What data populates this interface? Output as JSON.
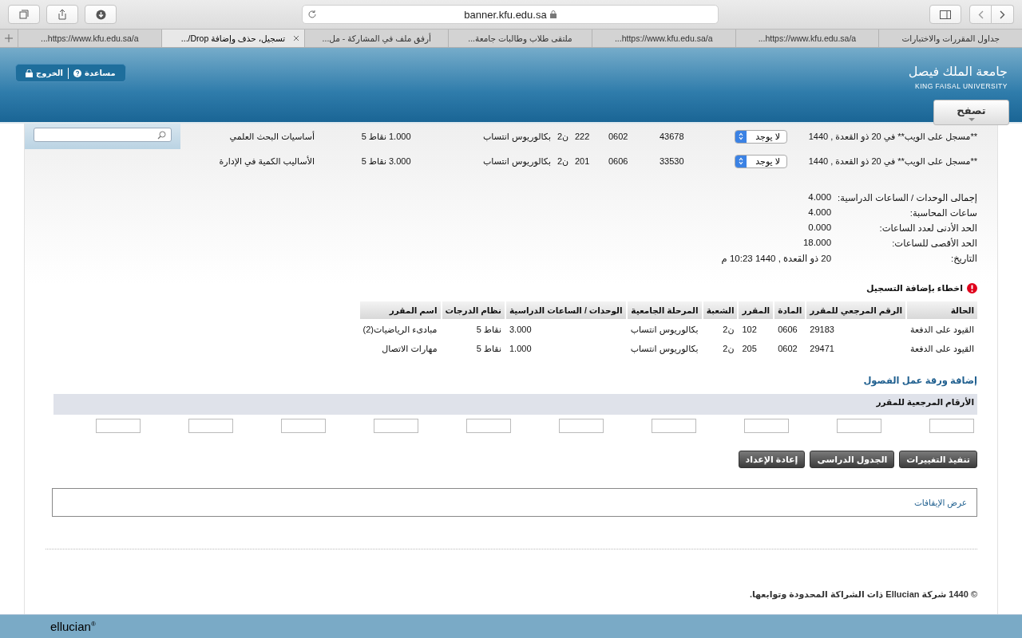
{
  "browser": {
    "url": "banner.kfu.edu.sa",
    "tabs": [
      {
        "title": "جداول المقررات والاختبارات",
        "selected": false
      },
      {
        "title": "https://www.kfu.edu.sa/a...",
        "selected": false
      },
      {
        "title": "https://www.kfu.edu.sa/a...",
        "selected": false
      },
      {
        "title": "ملتقى طلاب وطالبات جامعة...",
        "selected": false
      },
      {
        "title": "أرفق ملف في المشاركة - مل...",
        "selected": false
      },
      {
        "title": "تسجيل، حذف وإضافة Drop/...",
        "selected": true
      },
      {
        "title": "https://www.kfu.edu.sa/a...",
        "selected": false
      }
    ]
  },
  "header": {
    "logout": "الخروج",
    "help": "مساعدة",
    "logo_ar": "جامعة الملك فيصل",
    "logo_en": "KING FAISAL UNIVERSITY",
    "browse": "تصفح"
  },
  "registered": [
    {
      "status": "**مسجل على الويب** في 20 ذو القعدة , 1440",
      "action": "لا يوجد",
      "crn": "43678",
      "subject": "0602",
      "course": "222",
      "section": "ن2",
      "level": "بكالوريوس انتساب",
      "credits": "1.000",
      "grade_mode": "نقاط 5",
      "title": "أساسيات البحث العلمي"
    },
    {
      "status": "**مسجل على الويب** في 20 ذو القعدة , 1440",
      "action": "لا يوجد",
      "crn": "33530",
      "subject": "0606",
      "course": "201",
      "section": "ن2",
      "level": "بكالوريوس انتساب",
      "credits": "3.000",
      "grade_mode": "نقاط 5",
      "title": "الأساليب الكمية في الإدارة"
    }
  ],
  "summary": [
    {
      "label": "إجمالى الوحدات / الساعات الدراسية:",
      "value": "4.000"
    },
    {
      "label": "ساعات المحاسبة:",
      "value": "4.000"
    },
    {
      "label": "الحد الأدنى لعدد الساعات:",
      "value": "0.000"
    },
    {
      "label": "الحد الأقصى للساعات:",
      "value": "18.000"
    },
    {
      "label": "التاريخ:",
      "value": "20 ذو القعدة , 1440 10:23 م"
    }
  ],
  "errors": {
    "title": "اخطاء بإضافة التسجيل",
    "columns": [
      "الحالة",
      "الرقم المرجعي للمقرر",
      "المادة",
      "المقرر",
      "الشعبة",
      "المرحلة الجامعية",
      "الوحدات / الساعات الدراسية",
      "نظام الدرجات",
      "اسم المقرر"
    ],
    "rows": [
      [
        "القيود على الدفعة",
        "29183",
        "0606",
        "102",
        "ن2",
        "بكالوريوس انتساب",
        "3.000",
        "نقاط 5",
        "مبادىء الرياضيات(2)"
      ],
      [
        "القيود على الدفعة",
        "29471",
        "0602",
        "205",
        "ن2",
        "بكالوريوس انتساب",
        "1.000",
        "نقاط 5",
        "مهارات الاتصال"
      ]
    ]
  },
  "worksheet": {
    "title": "إضافة ورقة عمل الفصول",
    "label": "الأرقام المرجعية للمقرر"
  },
  "buttons": [
    "تنفيذ التغييرات",
    "الجدول الدراسى",
    "إعادة الإعداد"
  ],
  "holds_link": "عرض الإيقافات",
  "copyright": "© 1440 شركة **Ellucian** ذات الشراكة المحدودة وتوابعها.",
  "footer_logo": "ellucian$^{®}$"
}
